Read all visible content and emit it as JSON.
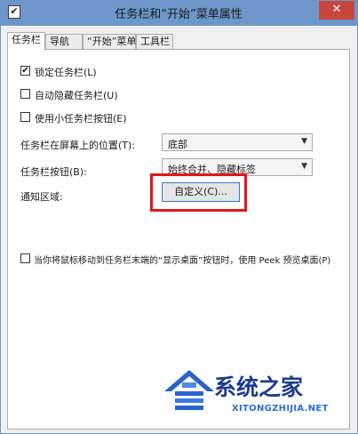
{
  "window": {
    "title": "任务栏和“开始”菜单属性",
    "close_glyph": "✕",
    "icon": "checkbox-app-icon"
  },
  "tabs": [
    {
      "label": "任务栏"
    },
    {
      "label": "导航"
    },
    {
      "label": "“开始”菜单"
    },
    {
      "label": "工具栏"
    }
  ],
  "options": {
    "lock_taskbar": {
      "label": "锁定任务栏(L)",
      "checked": true
    },
    "auto_hide": {
      "label": "自动隐藏任务栏(U)",
      "checked": false
    },
    "small_buttons": {
      "label": "使用小任务栏按钮(E)",
      "checked": false
    }
  },
  "position": {
    "label": "任务栏在屏幕上的位置(T):",
    "value": "底部"
  },
  "buttons": {
    "label": "任务栏按钮(B):",
    "value": "始终合并、隐藏标签"
  },
  "notification": {
    "label": "通知区域:",
    "button": "自定义(C)..."
  },
  "peek": {
    "label": "当你将鼠标移动到任务栏末端的“显示桌面”按钮时，使用 Peek 预览桌面(P)",
    "checked": false
  },
  "watermark": {
    "text": "系统之家",
    "sub": "XITONGZHIJIA.NET"
  },
  "colors": {
    "titlebar": "#6d97ca",
    "highlight": "#e0161d",
    "watermark": "#1c3a8c"
  }
}
